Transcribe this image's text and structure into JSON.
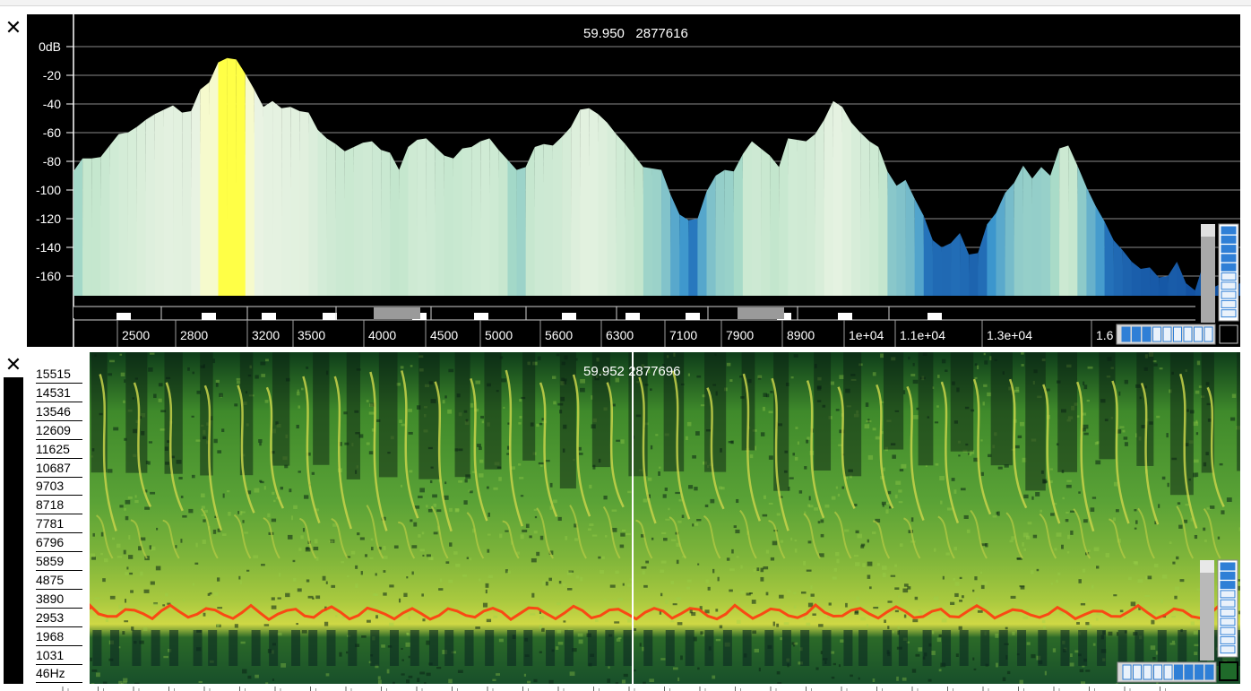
{
  "spectrum": {
    "readout_time": "59.950",
    "readout_sample": "2877616",
    "db_labels": [
      "0dB",
      "-20",
      "-40",
      "-60",
      "-80",
      "-100",
      "-120",
      "-140",
      "-160"
    ],
    "freq_labels": [
      "2500",
      "2800",
      "3200",
      "3500",
      "4000",
      "4500",
      "5000",
      "5600",
      "6300",
      "7100",
      "7900",
      "8900",
      "1e+04",
      "1.1e+04",
      "1.3e+04",
      "1.6"
    ],
    "envelope_db": [
      -87,
      -78,
      -78,
      -77,
      -69,
      -61,
      -60,
      -56,
      -51,
      -47,
      -44,
      -41,
      -46,
      -45,
      -30,
      -25,
      -11,
      -8,
      -9,
      -19,
      -30,
      -42,
      -38,
      -43,
      -42,
      -45,
      -46,
      -58,
      -64,
      -68,
      -73,
      -70,
      -67,
      -66,
      -72,
      -74,
      -86,
      -70,
      -65,
      -64,
      -70,
      -76,
      -78,
      -71,
      -70,
      -66,
      -64,
      -72,
      -79,
      -86,
      -84,
      -70,
      -68,
      -69,
      -63,
      -56,
      -44,
      -43,
      -47,
      -53,
      -61,
      -68,
      -76,
      -84,
      -85,
      -86,
      -103,
      -117,
      -121,
      -120,
      -101,
      -90,
      -86,
      -87,
      -75,
      -66,
      -71,
      -76,
      -84,
      -64,
      -65,
      -66,
      -61,
      -51,
      -38,
      -42,
      -53,
      -60,
      -66,
      -70,
      -87,
      -97,
      -93,
      -106,
      -118,
      -135,
      -140,
      -137,
      -130,
      -145,
      -144,
      -124,
      -116,
      -102,
      -95,
      -83,
      -92,
      -84,
      -90,
      -71,
      -69,
      -83,
      -98,
      -111,
      -122,
      -135,
      -142,
      -150,
      -155,
      -154,
      -161,
      -160,
      -150,
      -165,
      -170,
      -150,
      -168,
      -165,
      -168,
      -165
    ]
  },
  "waterfall": {
    "readout_time": "59.952",
    "readout_sample": "2877696",
    "freq_labels": [
      "15515",
      "14531",
      "13546",
      "12609",
      "11625",
      "10687",
      "9703",
      "8718",
      "7781",
      "6796",
      "5859",
      "4875",
      "3890",
      "2953",
      "1968",
      "1031",
      "46Hz"
    ]
  },
  "icons": {
    "close": "close-icon"
  },
  "colors": {
    "peak": "#ffff40",
    "low": "#1a5fa8",
    "mid": "#dcefdc",
    "trace": "#ff3a10"
  }
}
